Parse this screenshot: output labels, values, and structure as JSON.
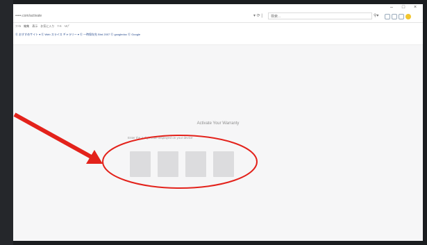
{
  "browser": {
    "url": "•••••.com/activate",
    "search_text": "検索...",
    "search_icon": "magnifier-icon",
    "window_controls": [
      "–",
      "□",
      "×"
    ],
    "menu_items": [
      "ﾌｧｲﾙ",
      "編集",
      "表示",
      "お気に入り",
      "ﾂｰﾙ",
      "ﾍﾙﾌﾟ"
    ],
    "favorites_bar": "Ⓔ おすすめサイト ▾  Ⓔ Web スライス ギャラリー ▾   Ⓔ 一時保存先 Bird 2007   Ⓔ googledoc   Ⓔ Google"
  },
  "page": {
    "title": "Activate Your Warranty",
    "subtitle": "Enter the 4-digit code displayed on your device",
    "digit_count": 4
  },
  "annotation": {
    "color": "#e3221b"
  }
}
